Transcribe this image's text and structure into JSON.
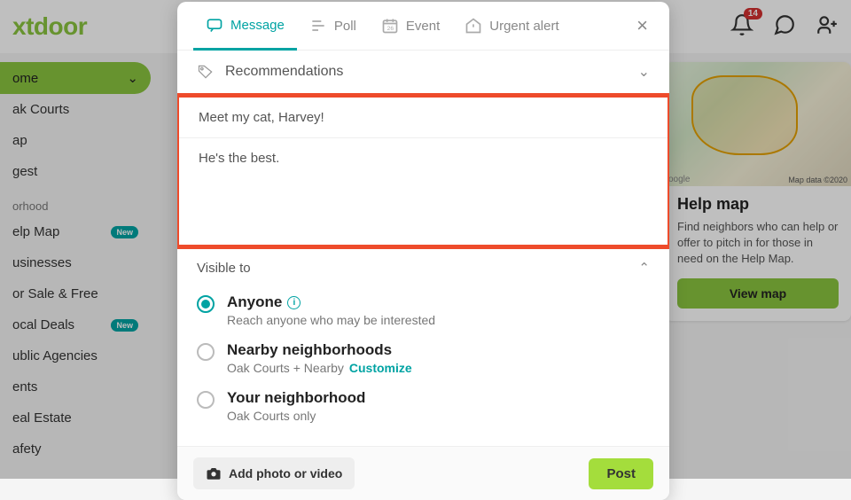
{
  "logo": "xtdoor",
  "header": {
    "notif_count": "14"
  },
  "sidebar": {
    "home": "ome",
    "items": [
      "ak Courts",
      "ap",
      "gest"
    ],
    "section": "orhood",
    "items2": [
      {
        "label": "elp Map",
        "new": true
      },
      {
        "label": "usinesses",
        "new": false
      },
      {
        "label": "or Sale & Free",
        "new": false
      },
      {
        "label": "ocal Deals",
        "new": true
      },
      {
        "label": "ublic Agencies",
        "new": false
      },
      {
        "label": "ents",
        "new": false
      },
      {
        "label": "eal Estate",
        "new": false
      },
      {
        "label": "afety",
        "new": false
      }
    ],
    "new_label": "New"
  },
  "help": {
    "google": "oogle",
    "attr": "Map data ©2020",
    "title": "Help map",
    "text": "Find neighbors who can help or offer to pitch in for those in need on the Help Map.",
    "button": "View map"
  },
  "modal": {
    "tabs": {
      "message": "Message",
      "poll": "Poll",
      "event": "Event",
      "urgent": "Urgent alert"
    },
    "recommendations": "Recommendations",
    "title_value": "Meet my cat, Harvey!",
    "body_value": "He's the best.",
    "visible_to": "Visible to",
    "options": [
      {
        "label": "Anyone",
        "sub": "Reach anyone who may be interested",
        "checked": true,
        "info": true
      },
      {
        "label": "Nearby neighborhoods",
        "sub": "Oak Courts + Nearby",
        "checked": false,
        "customize": "Customize"
      },
      {
        "label": "Your neighborhood",
        "sub": "Oak Courts only",
        "checked": false
      }
    ],
    "add_photo": "Add photo or video",
    "post": "Post"
  }
}
